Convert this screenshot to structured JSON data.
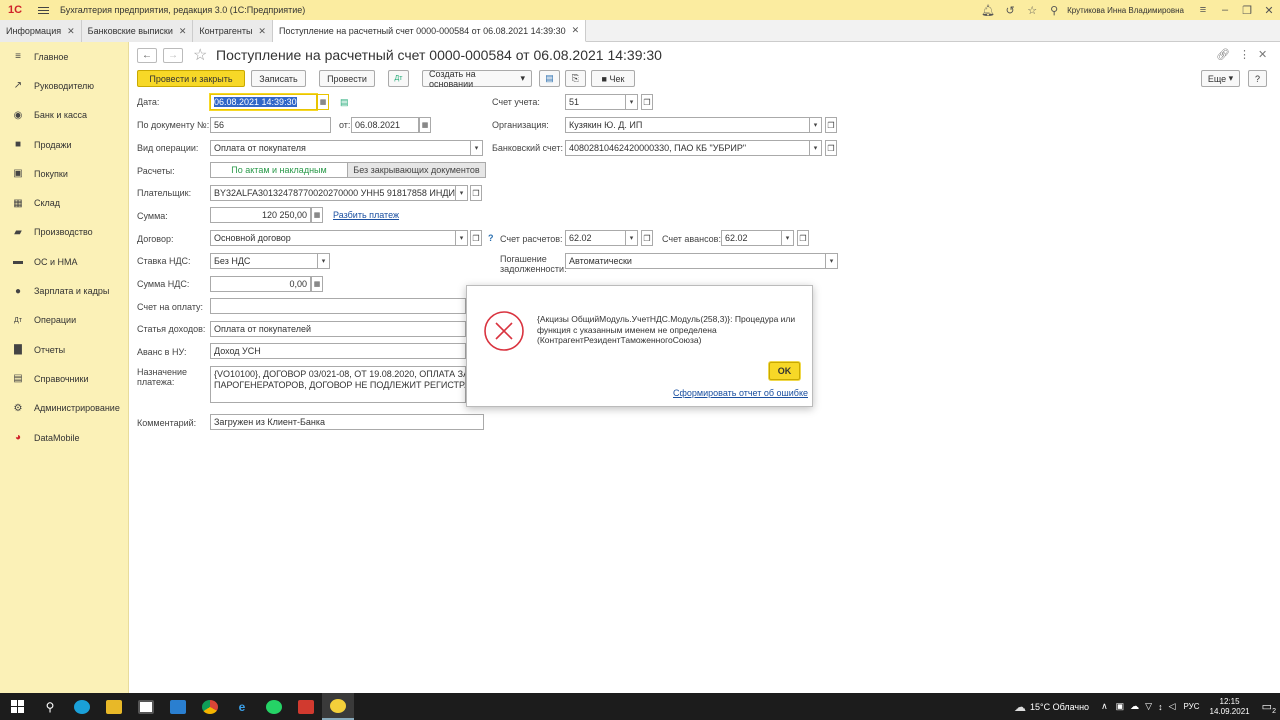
{
  "app": {
    "title": "Бухгалтерия предприятия, редакция 3.0  (1С:Предприятие)",
    "logo": "1С",
    "user": "Крутикова Инна Владимировна"
  },
  "tabs": [
    {
      "label": "Информация"
    },
    {
      "label": "Банковские выписки"
    },
    {
      "label": "Контрагенты"
    },
    {
      "label": "Поступление на расчетный счет 0000-000584 от 06.08.2021 14:39:30"
    }
  ],
  "sidebar": {
    "items": [
      {
        "label": "Главное",
        "icon": "menu-icon"
      },
      {
        "label": "Руководителю",
        "icon": "chart-up-icon"
      },
      {
        "label": "Банк и касса",
        "icon": "bank-icon"
      },
      {
        "label": "Продажи",
        "icon": "bag-icon"
      },
      {
        "label": "Покупки",
        "icon": "cart-icon"
      },
      {
        "label": "Склад",
        "icon": "grid-icon"
      },
      {
        "label": "Производство",
        "icon": "factory-icon"
      },
      {
        "label": "ОС и НМА",
        "icon": "truck-icon"
      },
      {
        "label": "Зарплата и кадры",
        "icon": "person-icon"
      },
      {
        "label": "Операции",
        "icon": "dt-kt-icon"
      },
      {
        "label": "Отчеты",
        "icon": "bars-icon"
      },
      {
        "label": "Справочники",
        "icon": "book-icon"
      },
      {
        "label": "Администрирование",
        "icon": "gear-icon"
      },
      {
        "label": "DataMobile",
        "icon": "datamobile-icon"
      }
    ]
  },
  "doc": {
    "title": "Поступление на расчетный счет 0000-000584 от 06.08.2021 14:39:30",
    "toolbar": {
      "post_close": "Провести и закрыть",
      "save": "Записать",
      "post": "Провести",
      "create_based": "Создать на основании",
      "check": "Чек",
      "more": "Еще",
      "help": "?"
    },
    "date_label": "Дата:",
    "date_value": "06.08.2021 14:39:30",
    "docnum_label": "По документу №:",
    "docnum_value": "56",
    "from_label": "от:",
    "from_value": "06.08.2021",
    "optype_label": "Вид операции:",
    "optype_value": "Оплата от покупателя",
    "settle_label": "Расчеты:",
    "settle_opt1": "По актам и накладным",
    "settle_opt2": "Без закрывающих документов",
    "payer_label": "Плательщик:",
    "payer_value": "BY32ALFA30132478770020270000 УНН5 91817858 ИНДИВИД",
    "sum_label": "Сумма:",
    "sum_value": "120 250,00",
    "split_link": "Разбить платеж",
    "contract_label": "Договор:",
    "contract_value": "Основной договор",
    "vat_rate_label": "Ставка НДС:",
    "vat_rate_value": "Без НДС",
    "vat_sum_label": "Сумма НДС:",
    "vat_sum_value": "0,00",
    "invoice_label": "Счет на оплату:",
    "invoice_value": "",
    "income_label": "Статья доходов:",
    "income_value": "Оплата от покупателей",
    "advance_label": "Аванс в НУ:",
    "advance_value": "Доход УСН",
    "purpose_label1": "Назначение",
    "purpose_label2": "платежа:",
    "purpose_line1": "{VO10100}, ДОГОВОР 03/021-08, ОТ 19.08.2020, ОПЛАТА ЗА Т",
    "purpose_line2": "ПАРОГЕНЕРАТОРОВ, ДОГОВОР НЕ ПОДЛЕЖИТ РЕГИСТРАЦ",
    "comment_label": "Комментарий:",
    "comment_value": "Загружен из Клиент-Банка",
    "account_label": "Счет учета:",
    "account_value": "51",
    "org_label": "Организация:",
    "org_value": "Кузякин Ю. Д. ИП",
    "bank_label": "Банковский счет:",
    "bank_value": "40802810462420000330, ПАО КБ \"УБРИР\"",
    "settle_acc_label": "Счет расчетов:",
    "settle_acc_value": "62.02",
    "adv_acc_label": "Счет авансов:",
    "adv_acc_value": "62.02",
    "debt_label1": "Погашение",
    "debt_label2": "задолженности:",
    "debt_value": "Автоматически",
    "help_q": "?"
  },
  "dialog": {
    "message": "{Акцизы ОбщийМодуль.УчетНДС.Модуль(258,3)}: Процедура или функция с указанным именем не определена (КонтрагентРезидентТаможенногоСоюза)",
    "ok": "OK",
    "report_link": "Сформировать отчет об ошибке"
  },
  "taskbar": {
    "weather": "15°C  Облачно",
    "lang": "РУС",
    "time": "12:15",
    "date": "14.09.2021",
    "notif": "2"
  }
}
